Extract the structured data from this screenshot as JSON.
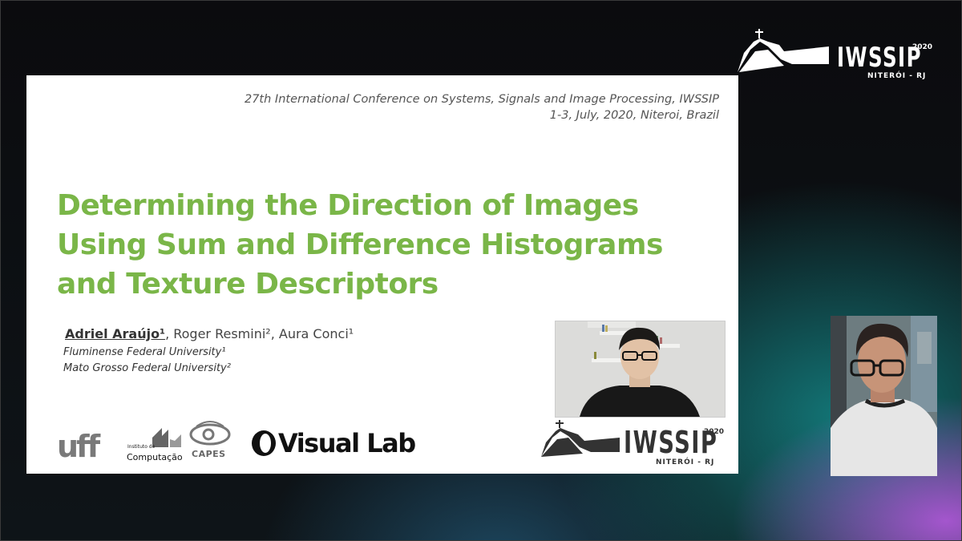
{
  "brand": {
    "wordmark": "IWSSIP",
    "year": "2020",
    "location": "NITERÓI - RJ"
  },
  "slide": {
    "conference_line1": "27th International Conference on Systems, Signals and Image Processing, IWSSIP",
    "conference_line2": "1-3, July, 2020, Niteroi, Brazil",
    "title_lines": [
      "Determining the Direction of Images",
      "Using Sum and Difference Histograms",
      "and Texture Descriptors"
    ],
    "authors": {
      "first": "Adriel Araújo¹",
      "rest": ", Roger Resmini², Aura Conci¹"
    },
    "affiliations": [
      "Fluminense Federal University¹",
      "Mato Grosso Federal University²"
    ],
    "logos": {
      "uff": "uff",
      "ic_small": "Instituto de",
      "ic_big": "Computação",
      "capes": "CAPES",
      "visual_lab": "Visual Lab"
    },
    "brand": {
      "wordmark": "IWSSIP",
      "year": "2020",
      "location": "NITERÓI - RJ"
    }
  },
  "colors": {
    "title_green": "#7ab648",
    "teal_glow": "#149696",
    "purple_glow": "#be5ae6"
  },
  "icons": [
    "christ-redeemer-mountain-logo",
    "capes-eye-logo",
    "visual-lab-logo"
  ]
}
